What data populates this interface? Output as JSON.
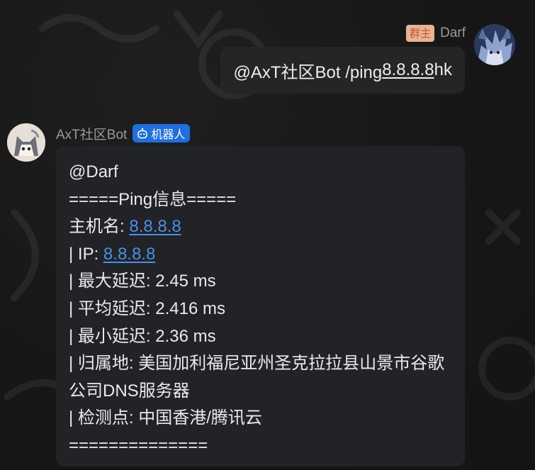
{
  "self_message": {
    "role_badge": "群主",
    "sender": "Darf",
    "mention": "@AxT社区Bot /ping ",
    "ip": "8.8.8.8",
    "suffix": " hk"
  },
  "bot_message": {
    "sender": "AxT社区Bot",
    "badge": "机器人",
    "lines": [
      {
        "prefix": "@Darf"
      },
      {
        "prefix": "=====Ping信息====="
      },
      {
        "prefix": "主机名: ",
        "link": "8.8.8.8"
      },
      {
        "prefix": "| IP: ",
        "link": "8.8.8.8"
      },
      {
        "prefix": "| 最大延迟: 2.45 ms"
      },
      {
        "prefix": "| 平均延迟: 2.416 ms"
      },
      {
        "prefix": "| 最小延迟: 2.36 ms"
      },
      {
        "prefix": "| 归属地: 美国加利福尼亚州圣克拉拉县山景市谷歌"
      },
      {
        "prefix": "公司DNS服务器"
      },
      {
        "prefix": "| 检测点: 中国香港/腾讯云"
      },
      {
        "prefix": "=============="
      }
    ]
  },
  "icons": {
    "self_avatar": "anime-avatar",
    "bot_avatar": "cat-avatar",
    "bot_badge_icon": "robot-icon"
  },
  "colors": {
    "background": "#161616",
    "self_bubble": "#252525",
    "bot_bubble": "#212327",
    "link": "#4b8fe8",
    "bot_badge": "#1e6fe0",
    "role_badge_bg": "#e8b493",
    "role_badge_text": "#c0572a"
  }
}
